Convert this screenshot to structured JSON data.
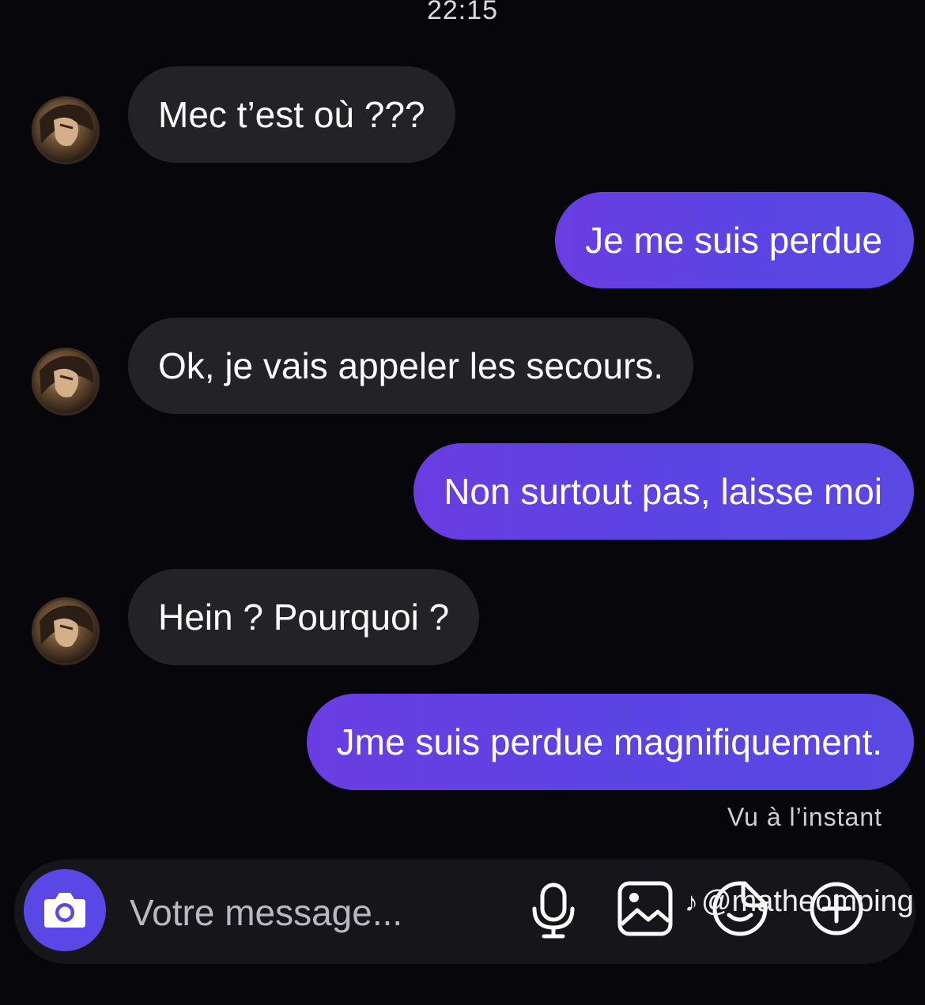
{
  "status": {
    "time": "22:15"
  },
  "conversation": {
    "messages": [
      {
        "direction": "incoming",
        "text": "Mec t’est où ???"
      },
      {
        "direction": "outgoing",
        "text": "Je me suis perdue"
      },
      {
        "direction": "incoming",
        "text": "Ok, je vais appeler les secours."
      },
      {
        "direction": "outgoing",
        "text": "Non surtout pas, laisse moi"
      },
      {
        "direction": "incoming",
        "text": "Hein ? Pourquoi ?"
      },
      {
        "direction": "outgoing",
        "text": "Jme suis perdue magnifiquement."
      }
    ],
    "seen_status": "Vu à l’instant"
  },
  "composer": {
    "placeholder": "Votre message...",
    "icons": [
      "camera-icon",
      "microphone-icon",
      "gallery-icon",
      "sticker-icon",
      "plus-icon"
    ]
  },
  "watermark": {
    "logo": "♪",
    "handle": "@matheomping"
  },
  "colors": {
    "background": "#07070b",
    "incoming_bubble": "#232327",
    "outgoing_bubble": "#5f44e3",
    "camera_button": "#5a48e6"
  }
}
